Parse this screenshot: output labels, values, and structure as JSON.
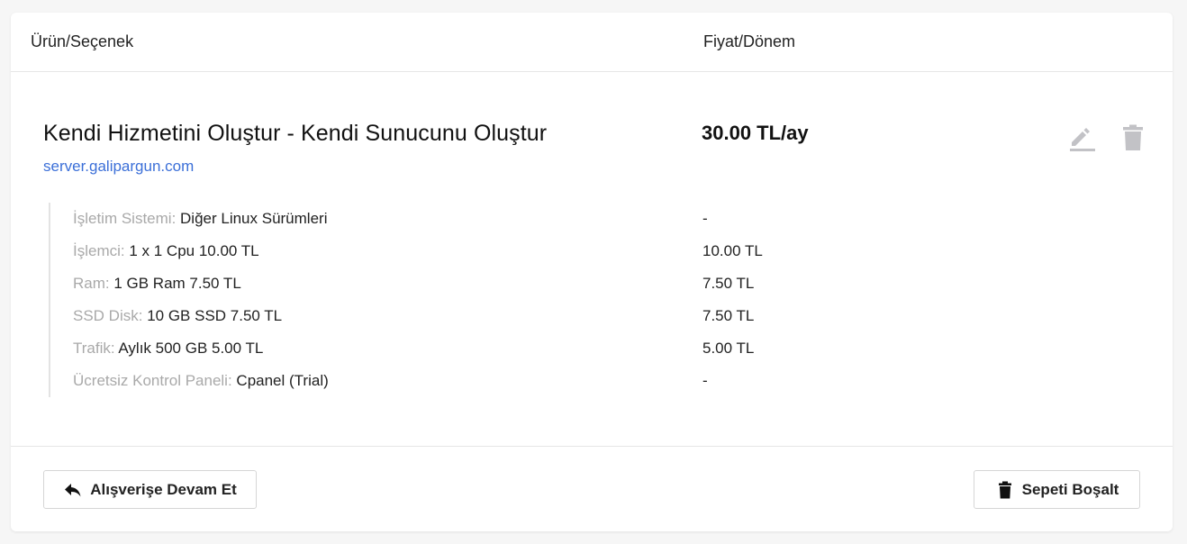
{
  "header": {
    "product_col": "Ürün/Seçenek",
    "price_col": "Fiyat/Dönem"
  },
  "product": {
    "title": "Kendi Hizmetini Oluştur - Kendi Sunucunu Oluştur",
    "domain": "server.galipargun.com",
    "price": "30.00 TL/ay",
    "edit_icon": "edit-pencil-icon",
    "delete_icon": "trash-icon"
  },
  "options": [
    {
      "label": "İşletim Sistemi:",
      "value": " Diğer Linux Sürümleri",
      "price": "-"
    },
    {
      "label": "İşlemci:",
      "value": " 1 x 1 Cpu 10.00 TL",
      "price": "10.00 TL"
    },
    {
      "label": "Ram:",
      "value": " 1 GB Ram 7.50 TL",
      "price": "7.50 TL"
    },
    {
      "label": "SSD Disk:",
      "value": " 10 GB SSD 7.50 TL",
      "price": "7.50 TL"
    },
    {
      "label": "Trafik:",
      "value": " Aylık 500 GB 5.00 TL",
      "price": "5.00 TL"
    },
    {
      "label": "Ücretsiz Kontrol Paneli:",
      "value": " Cpanel (Trial)",
      "price": "-"
    }
  ],
  "footer": {
    "continue_label": "Alışverişe Devam Et",
    "continue_icon": "reply-arrow-icon",
    "empty_label": "Sepeti Boşalt",
    "empty_icon": "trash-icon"
  },
  "colors": {
    "link": "#3b6fd8",
    "muted_label": "#a9a9a9",
    "icon_gray": "#c2c2c6"
  }
}
